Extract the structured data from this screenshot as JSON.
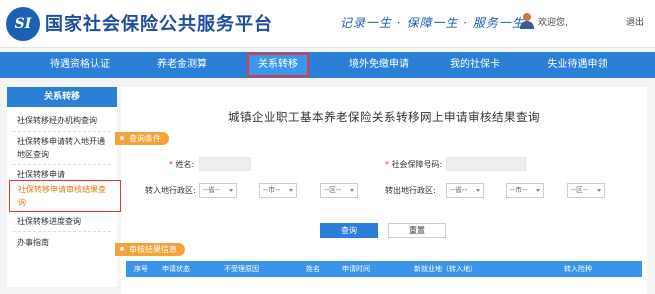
{
  "header": {
    "logo_text": "SI",
    "title": "国家社会保险公共服务平台",
    "slogan": "记录一生 · 保障一生 · 服务一生",
    "welcome": "欢迎您,",
    "logout": "退出"
  },
  "nav": {
    "items": [
      {
        "label": "待遇资格认证"
      },
      {
        "label": "养老金测算"
      },
      {
        "label": "关系转移"
      },
      {
        "label": "境外免缴申请"
      },
      {
        "label": "我的社保卡"
      },
      {
        "label": "失业待遇申领"
      }
    ],
    "active_index": 2
  },
  "sidebar": {
    "header": "关系转移",
    "items": [
      {
        "label": "社保转移经办机构查询"
      },
      {
        "label": "社保转移申请转入地开通地区查询"
      },
      {
        "label": "社保转移申请"
      },
      {
        "label": "社保转移申请审核结果查询"
      },
      {
        "label": "社保转移进度查询"
      },
      {
        "label": "办事指南"
      }
    ],
    "active_index": 3
  },
  "main": {
    "title": "城镇企业职工基本养老保险关系转移网上申请审核结果查询",
    "conditions_tag": "查询条件",
    "name_label": "姓名:",
    "ssn_label": "社会保障号码:",
    "required_mark": "*",
    "transfer_in_label": "转入地行政区:",
    "transfer_out_label": "转出地行政区:",
    "select_province": "--省--",
    "select_city": "--市--",
    "select_district": "--区--",
    "query_button": "查询",
    "reset_button": "重置",
    "results_tag": "审核结果信息",
    "table_headers": [
      "序号",
      "申请状态",
      "不受理原因",
      "姓名",
      "申请时间",
      "新就业地（转入地）",
      "转入险种"
    ]
  },
  "colors": {
    "brand_blue": "#2b7fd6",
    "highlight_red": "#e53935",
    "tag_orange": "#f4a23a"
  }
}
